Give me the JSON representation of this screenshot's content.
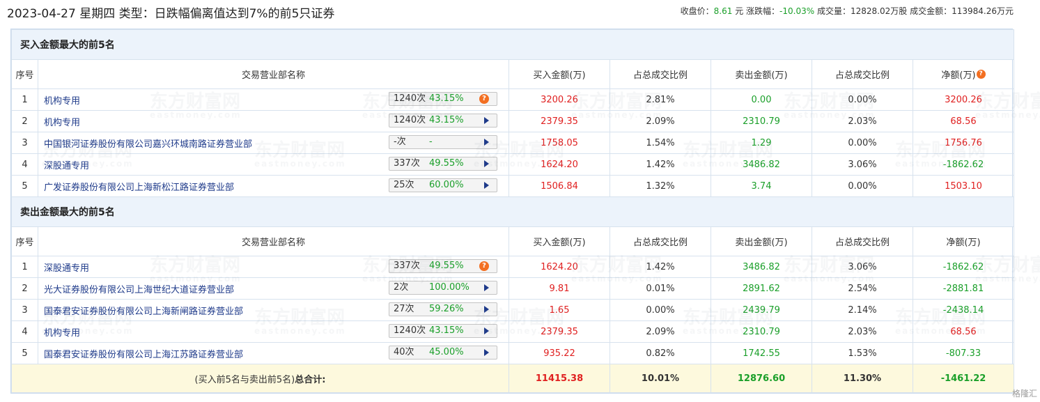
{
  "header": {
    "title": "2023-04-27 星期四 类型：日跌幅偏离值达到7%的前5只证券",
    "close_label": "收盘价：",
    "close_value": "8.61",
    "close_unit": "元",
    "change_label": "涨跌幅：",
    "change_value": "-10.03%",
    "volume_label": "成交量：",
    "volume_value": "12828.02万股",
    "turnover_label": "成交金额：",
    "turnover_value": "113984.26万元"
  },
  "columns": {
    "index": "序号",
    "name": "交易营业部名称",
    "buy": "买入金额(万)",
    "buy_ratio": "占总成交比例",
    "sell": "卖出金额(万)",
    "sell_ratio": "占总成交比例",
    "net": "净额(万)"
  },
  "buy_section": {
    "title": "买入金额最大的前5名",
    "rows": [
      {
        "idx": "1",
        "name": "机构专用",
        "count": "1240次",
        "rate": "43.15%",
        "buy": "3200.26",
        "buy_ratio": "2.81%",
        "sell": "0.00",
        "sell_ratio": "0.00%",
        "net": "3200.26"
      },
      {
        "idx": "2",
        "name": "机构专用",
        "count": "1240次",
        "rate": "43.15%",
        "buy": "2379.35",
        "buy_ratio": "2.09%",
        "sell": "2310.79",
        "sell_ratio": "2.03%",
        "net": "68.56"
      },
      {
        "idx": "3",
        "name": "中国银河证券股份有限公司嘉兴环城南路证券营业部",
        "count": "-次",
        "rate": "-",
        "buy": "1758.05",
        "buy_ratio": "1.54%",
        "sell": "1.29",
        "sell_ratio": "0.00%",
        "net": "1756.76"
      },
      {
        "idx": "4",
        "name": "深股通专用",
        "count": "337次",
        "rate": "49.55%",
        "buy": "1624.20",
        "buy_ratio": "1.42%",
        "sell": "3486.82",
        "sell_ratio": "3.06%",
        "net": "-1862.62"
      },
      {
        "idx": "5",
        "name": "广发证券股份有限公司上海新松江路证券营业部",
        "count": "25次",
        "rate": "60.00%",
        "buy": "1506.84",
        "buy_ratio": "1.32%",
        "sell": "3.74",
        "sell_ratio": "0.00%",
        "net": "1503.10"
      }
    ]
  },
  "sell_section": {
    "title": "卖出金额最大的前5名",
    "rows": [
      {
        "idx": "1",
        "name": "深股通专用",
        "count": "337次",
        "rate": "49.55%",
        "buy": "1624.20",
        "buy_ratio": "1.42%",
        "sell": "3486.82",
        "sell_ratio": "3.06%",
        "net": "-1862.62"
      },
      {
        "idx": "2",
        "name": "光大证券股份有限公司上海世纪大道证券营业部",
        "count": "2次",
        "rate": "100.00%",
        "buy": "9.81",
        "buy_ratio": "0.01%",
        "sell": "2891.62",
        "sell_ratio": "2.54%",
        "net": "-2881.81"
      },
      {
        "idx": "3",
        "name": "国泰君安证券股份有限公司上海新闸路证券营业部",
        "count": "27次",
        "rate": "59.26%",
        "buy": "1.65",
        "buy_ratio": "0.00%",
        "sell": "2439.79",
        "sell_ratio": "2.14%",
        "net": "-2438.14"
      },
      {
        "idx": "4",
        "name": "机构专用",
        "count": "1240次",
        "rate": "43.15%",
        "buy": "2379.35",
        "buy_ratio": "2.09%",
        "sell": "2310.79",
        "sell_ratio": "2.03%",
        "net": "68.56"
      },
      {
        "idx": "5",
        "name": "国泰君安证券股份有限公司上海江苏路证券营业部",
        "count": "40次",
        "rate": "45.00%",
        "buy": "935.22",
        "buy_ratio": "0.82%",
        "sell": "1742.55",
        "sell_ratio": "1.53%",
        "net": "-807.33"
      }
    ]
  },
  "total": {
    "label_prefix": "(买入前5名与卖出前5名)",
    "label_bold": "总合计:",
    "buy": "11415.38",
    "buy_ratio": "10.01%",
    "sell": "12876.60",
    "sell_ratio": "11.30%",
    "net": "-1461.22"
  },
  "icons": {
    "help": "question-mark-icon",
    "expand": "triangle-right-icon"
  },
  "watermark": {
    "text": "东方财富网",
    "sub": "eastmoney.com"
  },
  "corner_logo": "格隆汇",
  "colors": {
    "positive": "#e02020",
    "negative": "#1a9f29",
    "section_bg": "#ecf3fb",
    "total_bg": "#fdf9dd",
    "link": "#1e3a8a",
    "help_icon": "#f36f21"
  }
}
